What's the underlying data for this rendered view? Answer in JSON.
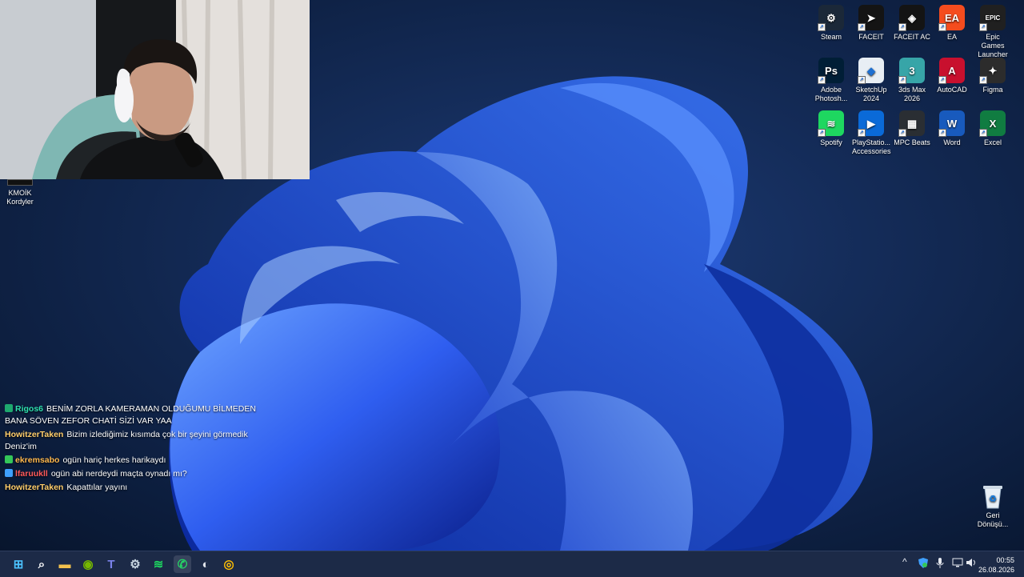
{
  "webcam": {
    "overlay_label": ""
  },
  "kmoik_icon": {
    "label_line1": "KMOİK",
    "label_line2": "Kordyler"
  },
  "desktop_icons": [
    {
      "name": "steam-shortcut",
      "label": "Steam",
      "icon": "steam-icon",
      "color": "#1b2838",
      "glyph": "⚙"
    },
    {
      "name": "faceit-shortcut",
      "label": "FACEIT",
      "icon": "faceit-icon",
      "color": "#141414",
      "glyph": "➤"
    },
    {
      "name": "faceit-ac-shortcut",
      "label": "FACEIT AC",
      "icon": "faceit-ac-icon",
      "color": "#141414",
      "glyph": "◈"
    },
    {
      "name": "ea-shortcut",
      "label": "EA",
      "icon": "ea-icon",
      "color": "#f54c1e",
      "glyph": "EA"
    },
    {
      "name": "epic-games-shortcut",
      "label": "Epic Games Launcher",
      "icon": "epic-games-icon",
      "color": "#202020",
      "glyph": "EPIC"
    },
    {
      "name": "photoshop-shortcut",
      "label": "Adobe Photosh...",
      "icon": "photoshop-icon",
      "color": "#001e36",
      "glyph": "Ps"
    },
    {
      "name": "sketchup-shortcut",
      "label": "SketchUp 2024",
      "icon": "sketchup-icon",
      "color": "#e8eef4",
      "glyph": "◆"
    },
    {
      "name": "3ds-max-shortcut",
      "label": "3ds Max 2026",
      "icon": "3ds-max-icon",
      "color": "#37a5a8",
      "glyph": "3"
    },
    {
      "name": "autocad-shortcut",
      "label": "AutoCAD",
      "icon": "autocad-icon",
      "color": "#c8102e",
      "glyph": "A"
    },
    {
      "name": "figma-shortcut",
      "label": "Figma",
      "icon": "figma-icon",
      "color": "#2c2c2c",
      "glyph": "✦"
    },
    {
      "name": "spotify-shortcut",
      "label": "Spotify",
      "icon": "spotify-icon",
      "color": "#1ed760",
      "glyph": "≋"
    },
    {
      "name": "playstation-accessories-shortcut",
      "label": "PlayStatio... Accessories",
      "icon": "playstation-icon",
      "color": "#0a6ad8",
      "glyph": "▶"
    },
    {
      "name": "mpc-beats-shortcut",
      "label": "MPC Beats",
      "icon": "mpc-beats-icon",
      "color": "#2a2e33",
      "glyph": "▦"
    },
    {
      "name": "word-shortcut",
      "label": "Word",
      "icon": "word-icon",
      "color": "#185abd",
      "glyph": "W"
    },
    {
      "name": "excel-shortcut",
      "label": "Excel",
      "icon": "excel-icon",
      "color": "#107c41",
      "glyph": "X"
    }
  ],
  "recycle_bin": {
    "label": "Geri Dönüşü..."
  },
  "chat": [
    {
      "user": "Rigos6",
      "user_color": "#2ee0b0",
      "badge_color": "#1ea86e",
      "message": "BENİM ZORLA KAMERAMAN OLDUĞUMU BİLMEDEN BANA SÖVEN ZEFOR CHATİ SİZİ VAR YAA"
    },
    {
      "user": "HowitzerTaken",
      "user_color": "#ffce6b",
      "badge_color": "",
      "message": "Bizim izlediğimiz kısımda çok bir şeyini görmedik Deniz'im"
    },
    {
      "user": "ekremsabo",
      "user_color": "#ffb84d",
      "badge_color": "#34c759",
      "message": "ogün hariç herkes harikaydı"
    },
    {
      "user": "lfaruukll",
      "user_color": "#ff5a5a",
      "badge_color": "#3fa0ff",
      "message": "ogün abi nerdeydi maçta oynadı mı?"
    },
    {
      "user": "HowitzerTaken",
      "user_color": "#ffce6b",
      "badge_color": "",
      "message": "Kapattılar yayını"
    }
  ],
  "taskbar": {
    "apps": [
      {
        "name": "start-button",
        "icon": "windows-start-icon",
        "glyph": "⊞",
        "color": "#4cc2ff"
      },
      {
        "name": "search-button",
        "icon": "search-icon",
        "glyph": "⌕",
        "color": "#ffffff"
      },
      {
        "name": "file-explorer-button",
        "icon": "folder-icon",
        "glyph": "▬",
        "color": "#f2c14e"
      },
      {
        "name": "nvidia-button",
        "icon": "nvidia-icon",
        "glyph": "◉",
        "color": "#76b900"
      },
      {
        "name": "teams-button",
        "icon": "teams-icon",
        "glyph": "T",
        "color": "#7b83eb"
      },
      {
        "name": "steam-taskbar-button",
        "icon": "steam-icon",
        "glyph": "⚙",
        "color": "#c7d5e0"
      },
      {
        "name": "spotify-taskbar-button",
        "icon": "spotify-icon",
        "glyph": "≋",
        "color": "#1ed760"
      },
      {
        "name": "whatsapp-taskbar-button",
        "icon": "whatsapp-icon",
        "glyph": "✆",
        "color": "#25d366"
      },
      {
        "name": "discord-taskbar-button",
        "icon": "discord-icon",
        "glyph": "◐",
        "color": "#dfe3ea"
      },
      {
        "name": "chrome-taskbar-button",
        "icon": "chrome-icon",
        "glyph": "◎",
        "color": "#fbbc05"
      }
    ],
    "tray": {
      "chevron": "^",
      "time": "00:55",
      "date": "26.08.2026"
    }
  }
}
